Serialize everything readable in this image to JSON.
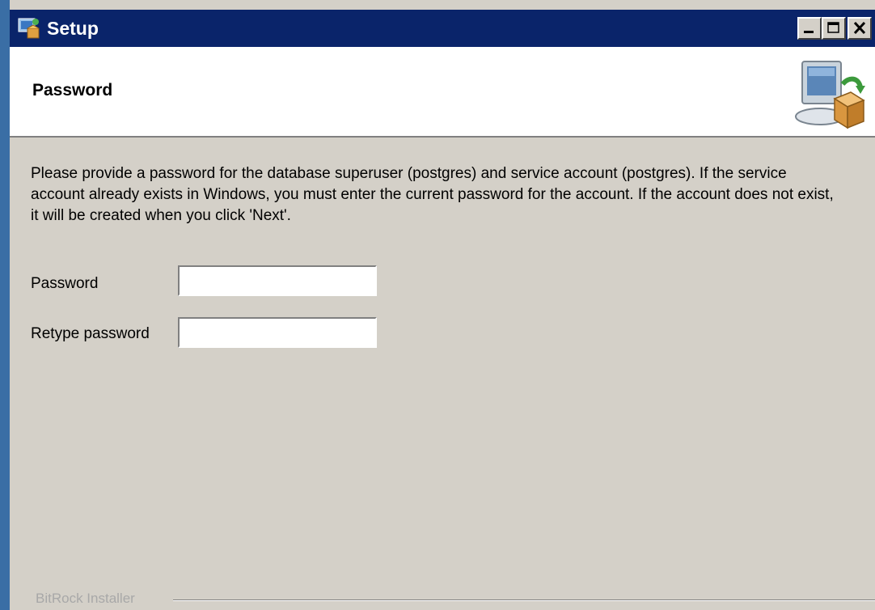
{
  "window": {
    "title": "Setup",
    "controls": [
      "minimize",
      "maximize",
      "close"
    ]
  },
  "header": {
    "title": "Password",
    "graphic": "computer-box-installer-icon"
  },
  "content": {
    "description": "Please provide a password for the database superuser (postgres) and service account (postgres). If the service account already exists in Windows, you must enter the current password for the account. If the account does not exist, it will be created when you click 'Next'.",
    "fields": {
      "password_label": "Password",
      "password_value": "",
      "retype_label": "Retype password",
      "retype_value": ""
    }
  },
  "footer": {
    "brand": "BitRock Installer"
  },
  "colors": {
    "titlebar": "#0a246a",
    "dialog_bg": "#d4d0c8",
    "header_bg": "#ffffff",
    "brand_text": "#a8a8a8"
  }
}
